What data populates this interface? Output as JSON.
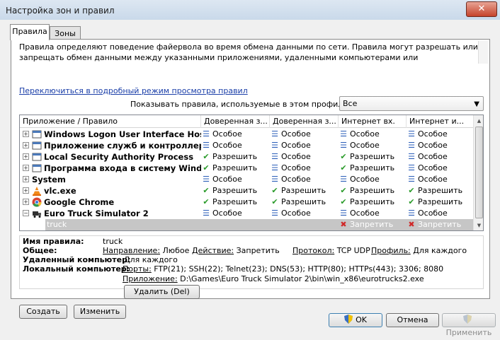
{
  "window": {
    "title": "Настройка зон и правил",
    "close_label": "✕"
  },
  "tabs": [
    {
      "label": "Правила"
    },
    {
      "label": "Зоны"
    }
  ],
  "description": "Правила определяют поведение файервола во время обмена данными по сети. Правила могут разрешать или запрещать обмен данными между указанными приложениями, удаленными компьютерами или определенными портами. Дополнительную",
  "detail_mode_link": "Переключиться в подробный режим просмотра правил",
  "profile": {
    "label": "Показывать правила, используемые в этом профиле:",
    "value": "Все"
  },
  "columns": [
    "Приложение / Правило",
    "Доверенная з...",
    "Доверенная з...",
    "Интернет вх.",
    "Интернет и..."
  ],
  "rows": [
    {
      "name": "Windows Logon User Interface Host",
      "icon": "window-icon",
      "actions": [
        "Особое",
        "Особое",
        "Особое",
        "Особое"
      ],
      "kinds": [
        "list",
        "list",
        "list",
        "list"
      ]
    },
    {
      "name": "Приложение служб и контроллеров",
      "icon": "window-icon",
      "actions": [
        "Особое",
        "Особое",
        "Особое",
        "Особое"
      ],
      "kinds": [
        "list",
        "list",
        "list",
        "list"
      ]
    },
    {
      "name": "Local Security Authority Process",
      "icon": "window-icon",
      "actions": [
        "Разрешить",
        "Особое",
        "Разрешить",
        "Особое"
      ],
      "kinds": [
        "check",
        "list",
        "check",
        "list"
      ]
    },
    {
      "name": "Программа входа в систему Windows",
      "icon": "window-icon",
      "actions": [
        "Разрешить",
        "Особое",
        "Разрешить",
        "Особое"
      ],
      "kinds": [
        "check",
        "list",
        "check",
        "list"
      ]
    },
    {
      "name": "System",
      "icon": "",
      "actions": [
        "Особое",
        "Особое",
        "Особое",
        "Особое"
      ],
      "kinds": [
        "list",
        "list",
        "list",
        "list"
      ]
    },
    {
      "name": "vlc.exe",
      "icon": "vlc-cone-icon",
      "actions": [
        "Разрешить",
        "Разрешить",
        "Разрешить",
        "Разрешить"
      ],
      "kinds": [
        "check",
        "check",
        "check",
        "check"
      ]
    },
    {
      "name": "Google Chrome",
      "icon": "chrome-icon",
      "actions": [
        "Разрешить",
        "Разрешить",
        "Разрешить",
        "Разрешить"
      ],
      "kinds": [
        "check",
        "check",
        "check",
        "check"
      ]
    },
    {
      "name": "Euro Truck Simulator 2",
      "icon": "truck-app-icon",
      "actions": [
        "Особое",
        "Особое",
        "Особое",
        "Особое"
      ],
      "kinds": [
        "list",
        "list",
        "list",
        "list"
      ]
    }
  ],
  "subrule": {
    "name": "truck",
    "actions": [
      "",
      "",
      "Запретить",
      "Запретить"
    ]
  },
  "details": {
    "rule_name_label": "Имя правила:",
    "rule_name": "truck",
    "general_label": "Общее:",
    "direction_label": "Направление:",
    "direction": "Любое",
    "action_label": "Действие:",
    "action": "Запретить",
    "protocol_label": "Протокол:",
    "protocol": "TCP UDP",
    "profile_label": "Профиль:",
    "profile": "Для каждого",
    "remote_label": "Удаленный компьютер:",
    "remote": "Для каждого",
    "local_label": "Локальный компьютер:",
    "ports_label": "Порты:",
    "ports": "FTP(21); SSH(22); Telnet(23); DNS(53); HTTP(80); HTTPs(443); 3306; 8080",
    "app_label": "Приложение:",
    "app": "D:\\Games\\Euro Truck Simulator 2\\bin\\win_x86\\eurotrucks2.exe"
  },
  "buttons": {
    "create": "Создать",
    "edit": "Изменить",
    "delete": "Удалить (Del)",
    "ok": "OK",
    "cancel": "Отмена",
    "apply": "Применить"
  },
  "colors": {
    "allow": "#2a9b2a",
    "deny": "#d02828",
    "special": "#2a5db8",
    "selected": "#c6c6c6"
  }
}
